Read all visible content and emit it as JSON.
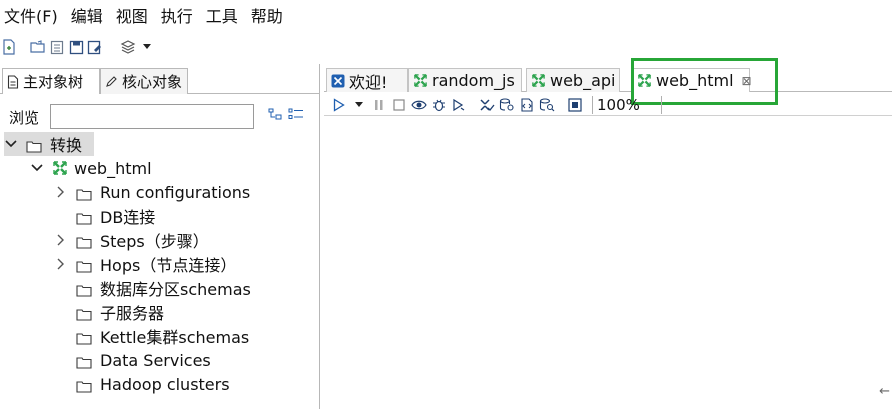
{
  "menu": [
    "文件(F)",
    "编辑",
    "视图",
    "执行",
    "工具",
    "帮助"
  ],
  "toolbar_icons": [
    "new-file-icon",
    "open-folder-icon",
    "explore-repo-icon",
    "save-icon",
    "save-as-icon",
    "layers-icon",
    "dropdown-arrow-icon"
  ],
  "left_tabs": [
    {
      "label": "主对象树",
      "icon": "document-icon"
    },
    {
      "label": "核心对象",
      "icon": "pencil-icon"
    }
  ],
  "browse": {
    "label": "浏览",
    "value": ""
  },
  "tree": [
    {
      "label": "转换",
      "depth": 0,
      "expander": "expanded",
      "icon": "folder",
      "selected": true
    },
    {
      "label": "web_html",
      "depth": 1,
      "expander": "expanded",
      "icon": "transform",
      "selected": false
    },
    {
      "label": "Run configurations",
      "depth": 2,
      "expander": "collapsed",
      "icon": "folder",
      "selected": false
    },
    {
      "label": "DB连接",
      "depth": 2,
      "expander": "none",
      "icon": "folder",
      "selected": false
    },
    {
      "label": "Steps（步骤）",
      "depth": 2,
      "expander": "collapsed",
      "icon": "folder",
      "selected": false
    },
    {
      "label": "Hops（节点连接）",
      "depth": 2,
      "expander": "collapsed",
      "icon": "folder",
      "selected": false
    },
    {
      "label": "数据库分区schemas",
      "depth": 2,
      "expander": "none",
      "icon": "folder",
      "selected": false
    },
    {
      "label": "子服务器",
      "depth": 2,
      "expander": "none",
      "icon": "folder",
      "selected": false
    },
    {
      "label": "Kettle集群schemas",
      "depth": 2,
      "expander": "none",
      "icon": "folder",
      "selected": false
    },
    {
      "label": "Data Services",
      "depth": 2,
      "expander": "none",
      "icon": "folder",
      "selected": false
    },
    {
      "label": "Hadoop clusters",
      "depth": 2,
      "expander": "none",
      "icon": "folder",
      "selected": false
    }
  ],
  "editor_tabs": [
    {
      "label": "欢迎!",
      "icon": "welcome-icon",
      "active": false
    },
    {
      "label": "random_js",
      "icon": "transform-icon",
      "active": false
    },
    {
      "label": "web_api",
      "icon": "transform-icon",
      "active": false
    },
    {
      "label": "web_html",
      "icon": "transform-icon",
      "active": true,
      "close": "⊠"
    }
  ],
  "run_toolbar_icons": [
    "run-icon",
    "run-dropdown-icon",
    "pause-icon",
    "stop-icon",
    "preview-icon",
    "debug-icon",
    "replay-icon",
    "verify-icon",
    "analyze-impact-icon",
    "sql-icon",
    "explore-db-icon",
    "show-results-icon"
  ],
  "zoom": "100%",
  "colors": {
    "highlight": "#27a637",
    "transform_icon": "#2ea44f",
    "welcome_icon": "#1f5fb0",
    "selected_row": "#dcdcdc"
  }
}
